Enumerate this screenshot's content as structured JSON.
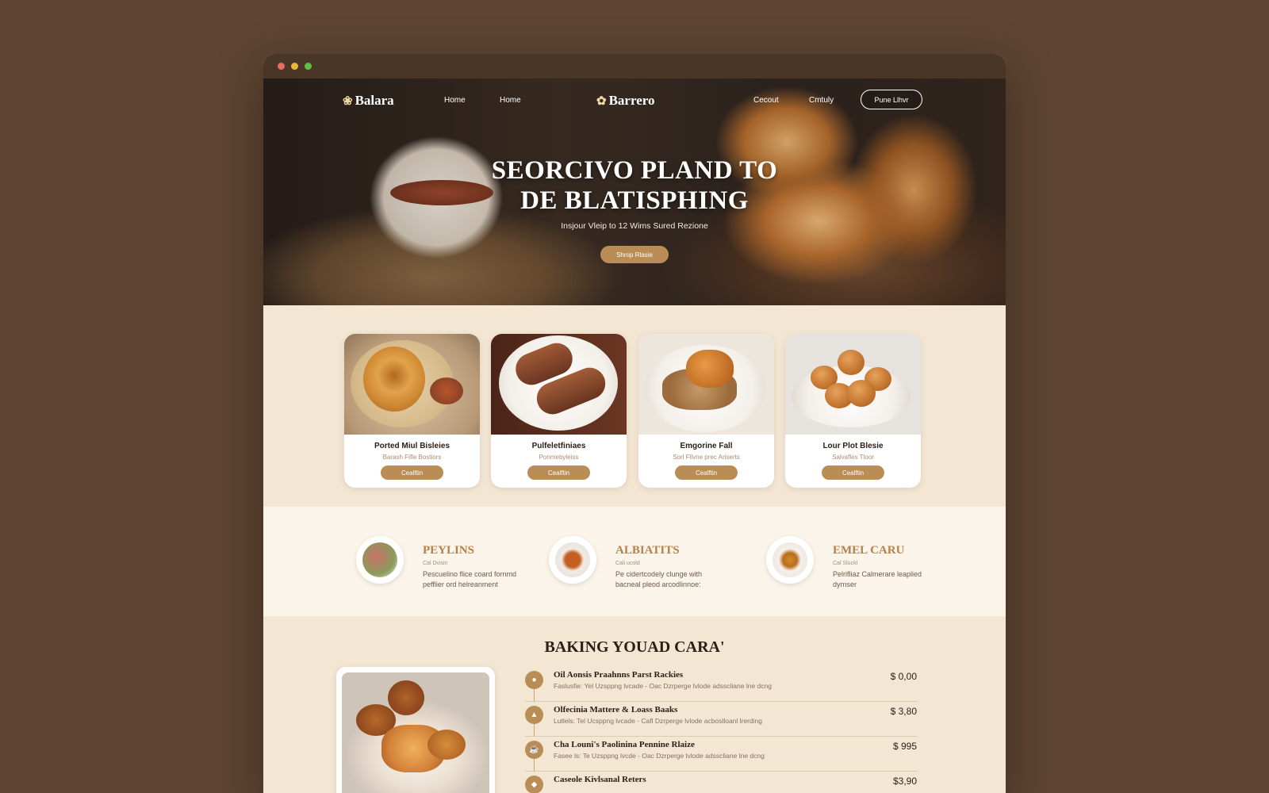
{
  "window": {
    "controls": [
      "close",
      "minimize",
      "maximize"
    ]
  },
  "nav": {
    "logo_left": "Balara",
    "logo_center": "Barrero",
    "links": [
      "Home",
      "Home",
      "Cecout",
      "Cmtuly"
    ],
    "cta": "Pune Llhvr"
  },
  "hero": {
    "title_line1": "SEORCIVO PLAND TO",
    "title_line2": "DE BLATISPHING",
    "subtitle": "Insjour Vleip to 12 Wims Sured Rezione",
    "button": "Shrop Rlasie"
  },
  "products": [
    {
      "name": "Ported Miul Bisleies",
      "sub": "Barash Fifle Bostiors",
      "button": "Cealftin"
    },
    {
      "name": "Pulfeletfiniaes",
      "sub": "Ponmebyleiss",
      "button": "Cealftin"
    },
    {
      "name": "Emgorine Fall",
      "sub": "Sorl Fllvne prec Ariserts",
      "button": "Cealftin"
    },
    {
      "name": "Lour Plot Blesie",
      "sub": "Salvafles Tloor",
      "button": "Cealftin"
    }
  ],
  "features": [
    {
      "title": "PEYLINS",
      "kicker": "Cal Dvisin",
      "text": "Pescuelino flice coard fornmd pefflier ord helreanment"
    },
    {
      "title": "ALBIATITS",
      "kicker": "Cali ucold",
      "text": "Pe cidertcodely clunge with bacneal pleod arcodlinnoe:"
    },
    {
      "title": "EMEL CARU",
      "kicker": "Cal Sluckl",
      "text": "Pelrifliaz Calmerare leaplied dyrnser"
    }
  ],
  "menu": {
    "title": "BAKING YOUAD CARA'",
    "items": [
      {
        "icon": "pin-icon",
        "name": "Oil Aonsis Praahnns Parst Rackies",
        "desc": "Faslusfie: Yel Uzsppng lvcade - Oac Dzrperge lvlode adsscliane lne dcng",
        "price": "$ 0,00"
      },
      {
        "icon": "cake-icon",
        "name": "Olfecinia Mattere & Loass Baaks",
        "desc": "Lutlels: Tel Ucsppng lvcade - Cafl Dzrperge lvlode acboslloanl lrerding",
        "price": "$ 3,80"
      },
      {
        "icon": "coffee-icon",
        "name": "Cha Louni's Paolinina Pennine Rlaize",
        "desc": "Fasee ls: Te Uzsppng lvcde - Oac Dzrperge lvlode adsscliane lne dcng",
        "price": "$ 995"
      },
      {
        "icon": "bread-icon",
        "name": "Caseole Kivlsanal Reters",
        "desc": "",
        "price": "$3,90"
      }
    ]
  },
  "colors": {
    "accent": "#b98d55",
    "brown_bg": "#5e4431",
    "cream": "#f3e6d3"
  }
}
